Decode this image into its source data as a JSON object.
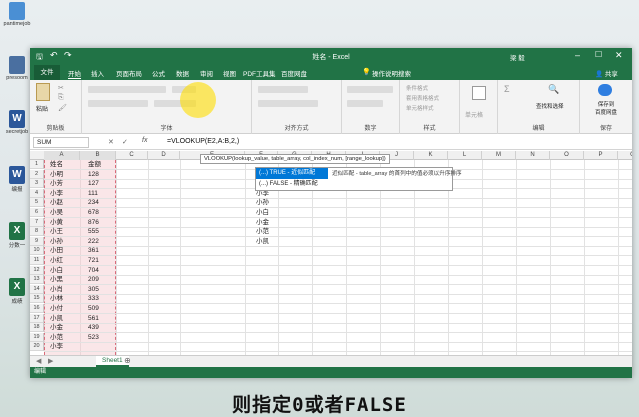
{
  "desktop_icons": [
    {
      "label": "pantimejob",
      "icon": "folder-icon",
      "color": "#4a8fd4"
    },
    {
      "label": "presoom",
      "icon": "monitor-icon",
      "color": "#4a6fa0"
    },
    {
      "label": "secretjob",
      "icon": "word-icon",
      "color": "#2b579a"
    },
    {
      "label": "编报",
      "icon": "word-icon",
      "color": "#2b579a"
    },
    {
      "label": "分数一",
      "icon": "excel-icon",
      "color": "#217346"
    },
    {
      "label": "成绩",
      "icon": "excel-icon",
      "color": "#217346"
    }
  ],
  "window": {
    "title": "姓名 - Excel",
    "user": "梁 毅",
    "share": "共享"
  },
  "tabs": {
    "file": "文件",
    "items": [
      "开始",
      "插入",
      "页面布局",
      "公式",
      "数据",
      "审阅",
      "视图",
      "PDF工具集",
      "百度网盘"
    ],
    "tellme": "操作说明搜索"
  },
  "ribbon": {
    "groups": [
      "剪贴板",
      "字体",
      "对齐方式",
      "数字",
      "样式",
      "单元格",
      "编辑",
      "保存"
    ],
    "buttons": {
      "paste": "粘贴",
      "cond": "条件格式",
      "table": "套用表格格式",
      "cellstyle": "单元格样式",
      "cells": "单元格",
      "sum": "Σ",
      "find": "查找和选择",
      "save_baidu": "保存到\n百度网盘"
    }
  },
  "formula_bar": {
    "name_box": "SUM",
    "fx": "fx",
    "formula": "=VLOOKUP(E2,A:B,2,)"
  },
  "tooltip": {
    "signature": "VLOOKUP(lookup_value, table_array, col_index_num, [range_lookup])"
  },
  "autocomplete": {
    "items": [
      "(...) TRUE - 近似匹配",
      "(...) FALSE - 精确匹配"
    ],
    "description": "近似匹配 - table_array 的首列中的值必须以升序排序"
  },
  "columns": [
    "A",
    "B",
    "C",
    "D",
    "E",
    "F",
    "G",
    "H",
    "I",
    "J",
    "K",
    "L",
    "M",
    "N",
    "O",
    "P",
    "Q"
  ],
  "rows": [
    {
      "n": "1",
      "a": "姓名",
      "b": "金额",
      "e": ""
    },
    {
      "n": "2",
      "a": "小明",
      "b": "128",
      "e": ""
    },
    {
      "n": "3",
      "a": "小芳",
      "b": "127",
      "e": ""
    },
    {
      "n": "4",
      "a": "小李",
      "b": "111",
      "e": "小李"
    },
    {
      "n": "5",
      "a": "小赵",
      "b": "234",
      "e": "小孙"
    },
    {
      "n": "6",
      "a": "小吴",
      "b": "678",
      "e": "小白"
    },
    {
      "n": "7",
      "a": "小黄",
      "b": "876",
      "e": "小金"
    },
    {
      "n": "8",
      "a": "小王",
      "b": "555",
      "e": "小范"
    },
    {
      "n": "9",
      "a": "小孙",
      "b": "222",
      "e": "小凯"
    },
    {
      "n": "10",
      "a": "小田",
      "b": "361",
      "e": ""
    },
    {
      "n": "11",
      "a": "小红",
      "b": "721",
      "e": ""
    },
    {
      "n": "12",
      "a": "小白",
      "b": "704",
      "e": ""
    },
    {
      "n": "13",
      "a": "小黑",
      "b": "209",
      "e": ""
    },
    {
      "n": "14",
      "a": "小肖",
      "b": "305",
      "e": ""
    },
    {
      "n": "15",
      "a": "小林",
      "b": "333",
      "e": ""
    },
    {
      "n": "16",
      "a": "小付",
      "b": "509",
      "e": ""
    },
    {
      "n": "17",
      "a": "小凯",
      "b": "561",
      "e": ""
    },
    {
      "n": "18",
      "a": "小金",
      "b": "439",
      "e": ""
    },
    {
      "n": "19",
      "a": "小范",
      "b": "523",
      "e": ""
    },
    {
      "n": "20",
      "a": "小李",
      "b": "",
      "e": ""
    }
  ],
  "sheet_tab": "Sheet1",
  "status": "编辑",
  "subtitle": "则指定0或者FALSE",
  "colors": {
    "excel_green": "#217346",
    "dark_green": "#185c37",
    "selection_blue": "#0078d7",
    "range_highlight": "#f4c7cc",
    "cursor_highlight": "#ffde00"
  }
}
